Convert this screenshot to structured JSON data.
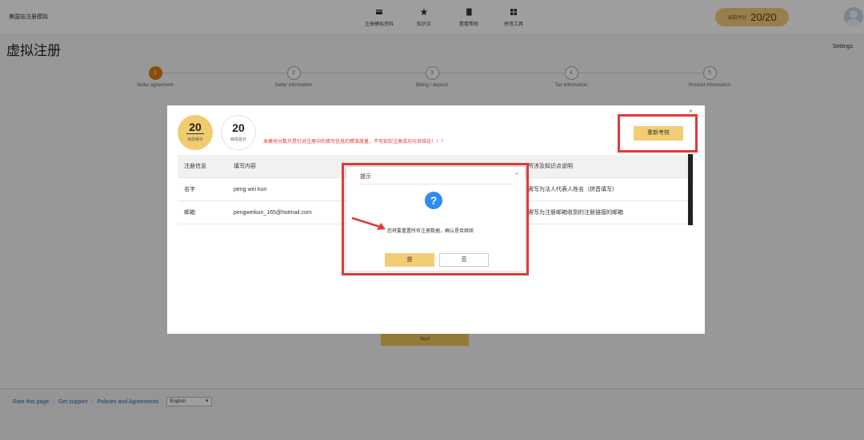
{
  "header": {
    "site_name": "美国站注册模拟",
    "nav": [
      {
        "label": "注册模拟资料",
        "icon": "card-icon"
      },
      {
        "label": "知识点",
        "icon": "star-icon"
      },
      {
        "label": "看看帮助",
        "icon": "book-icon"
      },
      {
        "label": "拼音工具",
        "icon": "grid-icon"
      }
    ],
    "score_label": "当前评分",
    "score_value": "20/20"
  },
  "page": {
    "title": "虚拟注册",
    "settings": "Settings",
    "steps": [
      {
        "num": "1",
        "label": "Seller agreement",
        "active": true
      },
      {
        "num": "2",
        "label": "Seller information",
        "active": false
      },
      {
        "num": "3",
        "label": "Billing / deposit",
        "active": false
      },
      {
        "num": "4",
        "label": "Tax information",
        "active": false
      },
      {
        "num": "5",
        "label": "Product information",
        "active": false
      }
    ],
    "next_label": "Next"
  },
  "footer": {
    "rate": "Rate this page",
    "support": "Get support",
    "policies": "Policies and Agreements",
    "language": "English"
  },
  "modal": {
    "close": "×",
    "current_score": "20",
    "current_label": "目前得分",
    "total_score": "20",
    "total_label": "目前总分",
    "note": "本模块分数只是针对注册中的填写信息的精准度量，不可如实注册成功与否结论！！！",
    "reset_label": "重新考核",
    "table": {
      "headers": [
        "注册信息",
        "填写内容",
        "",
        "所涉及知识点说明"
      ],
      "rows": [
        [
          "名字",
          "peng wei kun",
          "",
          "需写为法人代表人姓名（拼音填写）"
        ],
        [
          "邮箱",
          "pengweikun_165@hotmail.com",
          "",
          "需写为注册邮箱收到的注册链接的邮箱"
        ]
      ]
    }
  },
  "confirm": {
    "title": "提示",
    "close": "×",
    "icon": "question-icon",
    "message": "您将要重置所有注册数据，确认是否继续",
    "yes": "是",
    "no": "否"
  },
  "colors": {
    "accent": "#f2cd74",
    "highlight_frame": "#e03a3a",
    "step_active": "#e07b13",
    "info_icon": "#2f8cf0"
  }
}
